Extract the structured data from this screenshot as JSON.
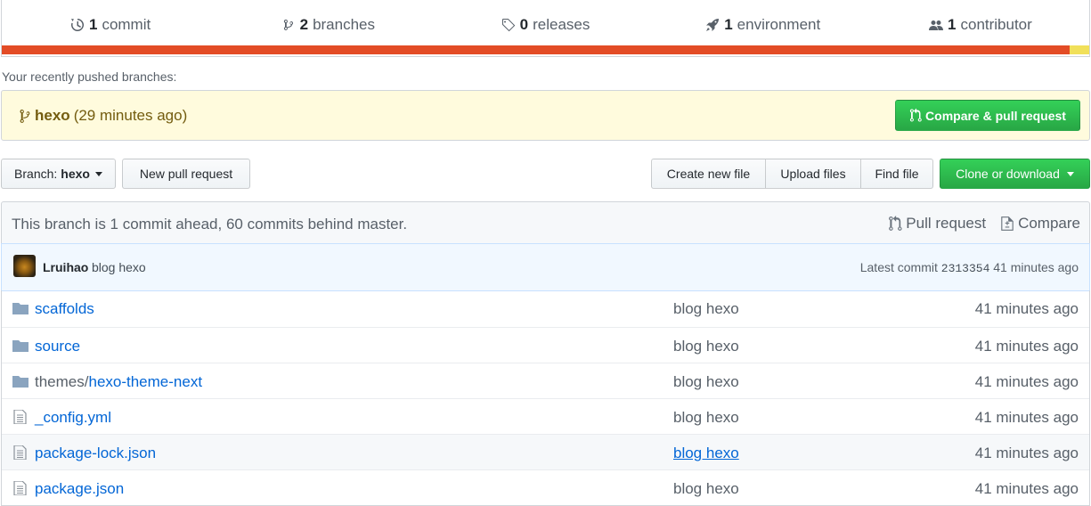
{
  "summary": {
    "commits": {
      "count": "1",
      "label": "commit",
      "icon": "history-icon"
    },
    "branches": {
      "count": "2",
      "label": "branches",
      "icon": "git-branch-icon"
    },
    "releases": {
      "count": "0",
      "label": "releases",
      "icon": "tag-icon"
    },
    "environments": {
      "count": "1",
      "label": "environment",
      "icon": "rocket-icon"
    },
    "contributors": {
      "count": "1",
      "label": "contributor",
      "icon": "people-icon"
    },
    "language_colors": [
      "#e34c26",
      "#f1e05a"
    ]
  },
  "recent": {
    "label": "Your recently pushed branches:",
    "branch": "hexo",
    "time": "(29 minutes ago)",
    "compare_button": "Compare & pull request"
  },
  "toolbar": {
    "branch_prefix": "Branch:",
    "branch_name": "hexo",
    "new_pr": "New pull request",
    "create_file": "Create new file",
    "upload_files": "Upload files",
    "find_file": "Find file",
    "clone": "Clone or download"
  },
  "branch_info": {
    "message": "This branch is 1 commit ahead, 60 commits behind master.",
    "pull_request": "Pull request",
    "compare": "Compare"
  },
  "commit": {
    "author": "Lruihao",
    "message": "blog hexo",
    "latest_label": "Latest commit",
    "sha": "2313354",
    "age": "41 minutes ago"
  },
  "files": [
    {
      "type": "dir",
      "prefix": "",
      "name": "scaffolds",
      "message": "blog hexo",
      "age": "41 minutes ago"
    },
    {
      "type": "dir",
      "prefix": "",
      "name": "source",
      "message": "blog hexo",
      "age": "41 minutes ago"
    },
    {
      "type": "dir",
      "prefix": "themes/",
      "name": "hexo-theme-next",
      "message": "blog hexo",
      "age": "41 minutes ago"
    },
    {
      "type": "file",
      "prefix": "",
      "name": "_config.yml",
      "message": "blog hexo",
      "age": "41 minutes ago"
    },
    {
      "type": "file",
      "prefix": "",
      "name": "package-lock.json",
      "message": "blog hexo",
      "age": "41 minutes ago"
    },
    {
      "type": "file",
      "prefix": "",
      "name": "package.json",
      "message": "blog hexo",
      "age": "41 minutes ago"
    }
  ]
}
